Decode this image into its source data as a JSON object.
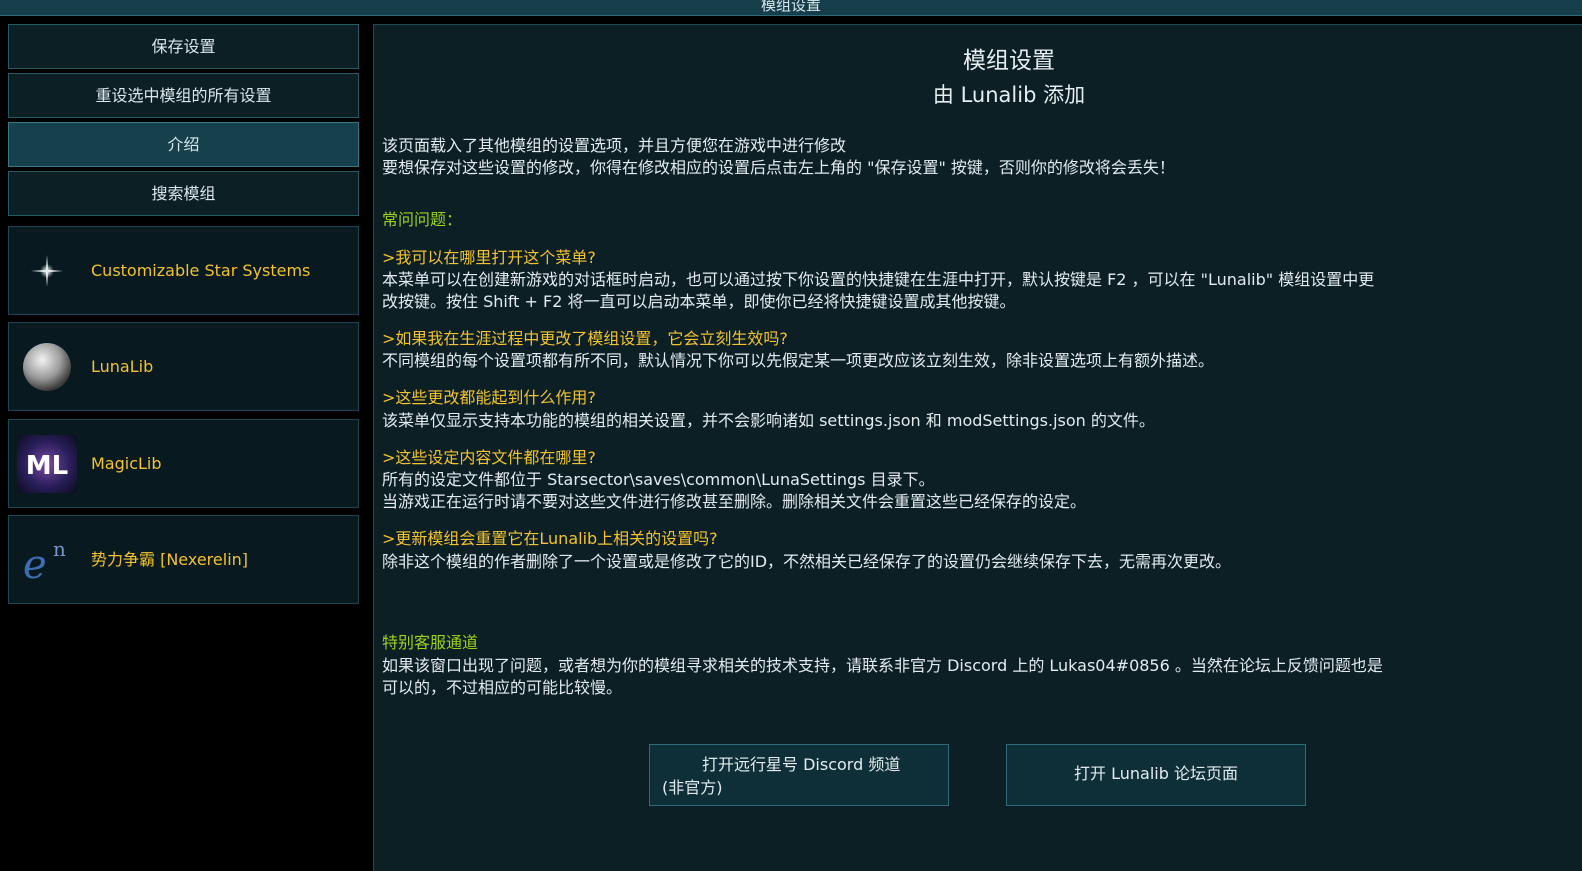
{
  "window": {
    "title": "模组设置"
  },
  "sidebar": {
    "buttons": [
      {
        "label": "保存设置"
      },
      {
        "label": "重设选中模组的所有设置"
      },
      {
        "label": "介绍"
      },
      {
        "label": "搜索模组"
      }
    ],
    "mods": [
      {
        "name": "Customizable Star Systems",
        "icon": "star-sparkle-icon"
      },
      {
        "name": "LunaLib",
        "icon": "moon-icon"
      },
      {
        "name": "MagicLib",
        "icon": "magiclib-logo-icon",
        "logo_text": "ML"
      },
      {
        "name": "势力争霸 [Nexerelin]",
        "icon": "nexerelin-logo-icon",
        "logo_text": "en"
      }
    ]
  },
  "main": {
    "title": "模组设置",
    "subtitle": "由 Lunalib 添加",
    "intro": [
      "该页面载入了其他模组的设置选项，并且方便您在游戏中进行修改",
      "要想保存对这些设置的修改，你得在修改相应的设置后点击左上角的 \"保存设置\" 按键，否则你的修改将会丢失！"
    ],
    "faq_heading": "常问问题：",
    "faq": [
      {
        "q": ">我可以在哪里打开这个菜单?",
        "a": [
          "本菜单可以在创建新游戏的对话框时启动，也可以通过按下你设置的快捷键在生涯中打开，默认按键是 F2 ，可以在 \"Lunalib\" 模组设置中更",
          "改按键。按住 Shift + F2 将一直可以启动本菜单，即使你已经将快捷键设置成其他按键。"
        ]
      },
      {
        "q": ">如果我在生涯过程中更改了模组设置，它会立刻生效吗?",
        "a": [
          "不同模组的每个设置项都有所不同，默认情况下你可以先假定某一项更改应该立刻生效，除非设置选项上有额外描述。"
        ]
      },
      {
        "q": ">这些更改都能起到什么作用?",
        "a": [
          "该菜单仅显示支持本功能的模组的相关设置，并不会影响诸如 settings.json 和 modSettings.json 的文件。"
        ]
      },
      {
        "q": ">这些设定内容文件都在哪里?",
        "a": [
          "所有的设定文件都位于 Starsector\\saves\\common\\LunaSettings 目录下。",
          "当游戏正在运行时请不要对这些文件进行修改甚至删除。删除相关文件会重置这些已经保存的设定。"
        ]
      },
      {
        "q": ">更新模组会重置它在Lunalib上相关的设置吗?",
        "a": [
          "除非这个模组的作者删除了一个设置或是修改了它的ID，不然相关已经保存了的设置仍会继续保存下去，无需再次更改。"
        ]
      }
    ],
    "support_heading": "特别客服通道",
    "support": [
      "如果该窗口出现了问题，或者想为你的模组寻求相关的技术支持，请联系非官方 Discord 上的 Lukas04#0856 。当然在论坛上反馈问题也是",
      "可以的，不过相应的可能比较慢。"
    ],
    "buttons": {
      "discord_line1": "打开远行星号 Discord 频道",
      "discord_line2": "(非官方)",
      "forum": "打开 Lunalib 论坛页面"
    }
  },
  "colors": {
    "accent_yellow": "#f2c230",
    "accent_green": "#9bd21c",
    "panel": "#0c1f25",
    "border": "#2a5966"
  }
}
